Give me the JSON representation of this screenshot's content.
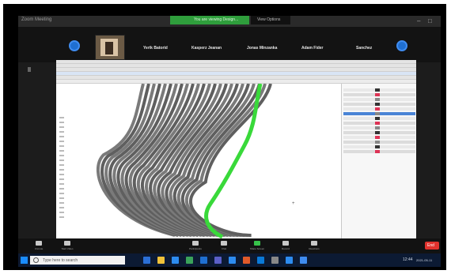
{
  "window": {
    "app_title": "Zoom Meeting"
  },
  "recording_banner": {
    "label": "You are viewing Design..."
  },
  "view_options": {
    "label": "View Options"
  },
  "participants": [
    {
      "name": "Yerik Batorid"
    },
    {
      "name": "Kasperz Jeanan"
    },
    {
      "name": "Jonas Minzanka"
    },
    {
      "name": "Adam Fider"
    },
    {
      "name": "Sanchez"
    }
  ],
  "controls": [
    {
      "label": "Unmute",
      "icon": "mic-muted-icon",
      "color": "#c8c8c8"
    },
    {
      "label": "Start Video",
      "icon": "video-off-icon",
      "color": "#c8c8c8"
    },
    {
      "label": "Participants",
      "icon": "participants-icon",
      "color": "#c8c8c8"
    },
    {
      "label": "Chat",
      "icon": "chat-icon",
      "color": "#c8c8c8"
    },
    {
      "label": "Share Screen",
      "icon": "share-screen-icon",
      "color": "#37c24a"
    },
    {
      "label": "Record",
      "icon": "record-icon",
      "color": "#c8c8c8"
    },
    {
      "label": "Reactions",
      "icon": "reactions-icon",
      "color": "#c8c8c8"
    }
  ],
  "end_button": {
    "label": "End"
  },
  "taskbar": {
    "search_placeholder": "Type here to search",
    "time": "12:44",
    "date": "2021-05-11"
  },
  "colors": {
    "zoom_green": "#2f9e3c",
    "zoom_blue": "#1f6fd1",
    "end_red": "#e0322d",
    "highlight_green": "#39d93a",
    "model_gray": "#6e6e6e"
  }
}
